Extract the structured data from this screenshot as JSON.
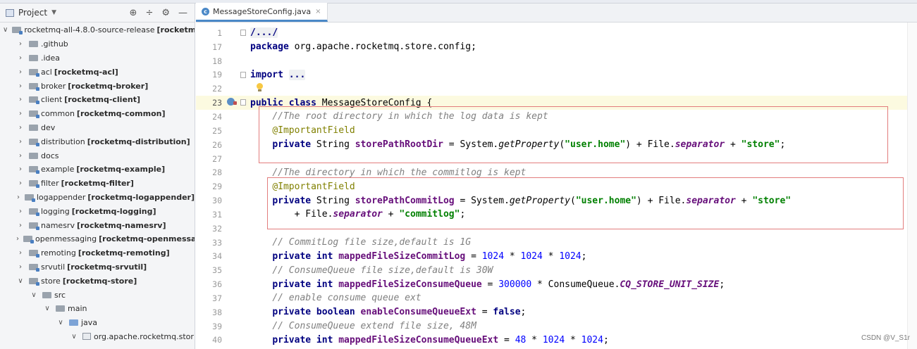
{
  "project_panel": {
    "title": "Project",
    "tree": [
      {
        "indent": 0,
        "arrow": "open",
        "icon": "module",
        "name": "rocketmq-all-4.8.0-source-release",
        "module": "[rocketm"
      },
      {
        "indent": 1,
        "arrow": "closed",
        "icon": "folder",
        "name": ".github",
        "module": ""
      },
      {
        "indent": 1,
        "arrow": "closed",
        "icon": "folder",
        "name": ".idea",
        "module": ""
      },
      {
        "indent": 1,
        "arrow": "closed",
        "icon": "module",
        "name": "acl",
        "module": "[rocketmq-acl]"
      },
      {
        "indent": 1,
        "arrow": "closed",
        "icon": "module",
        "name": "broker",
        "module": "[rocketmq-broker]"
      },
      {
        "indent": 1,
        "arrow": "closed",
        "icon": "module",
        "name": "client",
        "module": "[rocketmq-client]"
      },
      {
        "indent": 1,
        "arrow": "closed",
        "icon": "module",
        "name": "common",
        "module": "[rocketmq-common]"
      },
      {
        "indent": 1,
        "arrow": "closed",
        "icon": "folder",
        "name": "dev",
        "module": ""
      },
      {
        "indent": 1,
        "arrow": "closed",
        "icon": "module",
        "name": "distribution",
        "module": "[rocketmq-distribution]"
      },
      {
        "indent": 1,
        "arrow": "closed",
        "icon": "folder",
        "name": "docs",
        "module": ""
      },
      {
        "indent": 1,
        "arrow": "closed",
        "icon": "module",
        "name": "example",
        "module": "[rocketmq-example]"
      },
      {
        "indent": 1,
        "arrow": "closed",
        "icon": "module",
        "name": "filter",
        "module": "[rocketmq-filter]"
      },
      {
        "indent": 1,
        "arrow": "closed",
        "icon": "module",
        "name": "logappender",
        "module": "[rocketmq-logappender]"
      },
      {
        "indent": 1,
        "arrow": "closed",
        "icon": "module",
        "name": "logging",
        "module": "[rocketmq-logging]"
      },
      {
        "indent": 1,
        "arrow": "closed",
        "icon": "module",
        "name": "namesrv",
        "module": "[rocketmq-namesrv]"
      },
      {
        "indent": 1,
        "arrow": "closed",
        "icon": "module",
        "name": "openmessaging",
        "module": "[rocketmq-openmessa"
      },
      {
        "indent": 1,
        "arrow": "closed",
        "icon": "module",
        "name": "remoting",
        "module": "[rocketmq-remoting]"
      },
      {
        "indent": 1,
        "arrow": "closed",
        "icon": "module",
        "name": "srvutil",
        "module": "[rocketmq-srvutil]"
      },
      {
        "indent": 1,
        "arrow": "open",
        "icon": "module",
        "name": "store",
        "module": "[rocketmq-store]"
      },
      {
        "indent": 2,
        "arrow": "open",
        "icon": "folder",
        "name": "src",
        "module": ""
      },
      {
        "indent": 3,
        "arrow": "open",
        "icon": "folder",
        "name": "main",
        "module": ""
      },
      {
        "indent": 4,
        "arrow": "open",
        "icon": "src",
        "name": "java",
        "module": ""
      },
      {
        "indent": 5,
        "arrow": "open",
        "icon": "package",
        "name": "org.apache.rocketmq.stor",
        "module": ""
      }
    ]
  },
  "editor": {
    "tab_label": "MessageStoreConfig.java",
    "lines": [
      {
        "n": "1",
        "t": [
          [
            "fold",
            "/..."
          ],
          [
            "fold",
            "/"
          ]
        ]
      },
      {
        "n": "17",
        "t": [
          [
            "kw",
            "package"
          ],
          [
            "",
            " org.apache.rocketmq.store.config;"
          ]
        ]
      },
      {
        "n": "18",
        "t": []
      },
      {
        "n": "19",
        "t": [
          [
            "kw",
            "import"
          ],
          [
            "",
            " "
          ],
          [
            "fold",
            "..."
          ]
        ]
      },
      {
        "n": "22",
        "t": []
      },
      {
        "n": "23",
        "t": [
          [
            "kw",
            "public class"
          ],
          [
            "",
            " "
          ],
          [
            "ul",
            "MessageStoreConfig"
          ],
          [
            "",
            " {"
          ]
        ]
      },
      {
        "n": "24",
        "t": [
          [
            "",
            "    "
          ],
          [
            "cm",
            "//The root directory in which the log data is kept"
          ]
        ]
      },
      {
        "n": "25",
        "t": [
          [
            "",
            "    "
          ],
          [
            "an",
            "@ImportantField"
          ]
        ]
      },
      {
        "n": "26",
        "t": [
          [
            "",
            "    "
          ],
          [
            "kw",
            "private"
          ],
          [
            "",
            " String "
          ],
          [
            "fld",
            "storePathRootDir"
          ],
          [
            "",
            " = System."
          ],
          [
            "stat",
            "getProperty"
          ],
          [
            "",
            "("
          ],
          [
            "str",
            "\"user.home\""
          ],
          [
            "",
            ") + File."
          ],
          [
            "sfld",
            "separator"
          ],
          [
            "",
            " + "
          ],
          [
            "str",
            "\"store\""
          ],
          [
            "",
            ";"
          ]
        ]
      },
      {
        "n": "27",
        "t": []
      },
      {
        "n": "28",
        "t": [
          [
            "",
            "    "
          ],
          [
            "cm",
            "//The directory in which the commitlog is kept"
          ]
        ]
      },
      {
        "n": "29",
        "t": [
          [
            "",
            "    "
          ],
          [
            "an",
            "@ImportantField"
          ]
        ]
      },
      {
        "n": "30",
        "t": [
          [
            "",
            "    "
          ],
          [
            "kw",
            "private"
          ],
          [
            "",
            " String "
          ],
          [
            "fld",
            "storePathCommitLog"
          ],
          [
            "",
            " = System."
          ],
          [
            "stat",
            "getProperty"
          ],
          [
            "",
            "("
          ],
          [
            "str",
            "\"user.home\""
          ],
          [
            "",
            ") + File."
          ],
          [
            "sfld",
            "separator"
          ],
          [
            "",
            " + "
          ],
          [
            "str",
            "\"store\""
          ]
        ]
      },
      {
        "n": "31",
        "t": [
          [
            "",
            "        + File."
          ],
          [
            "sfld",
            "separator"
          ],
          [
            "",
            " + "
          ],
          [
            "str",
            "\"commitlog\""
          ],
          [
            "",
            ";"
          ]
        ]
      },
      {
        "n": "32",
        "t": []
      },
      {
        "n": "33",
        "t": [
          [
            "",
            "    "
          ],
          [
            "cm",
            "// CommitLog file size,default is 1G"
          ]
        ]
      },
      {
        "n": "34",
        "t": [
          [
            "",
            "    "
          ],
          [
            "kw",
            "private int"
          ],
          [
            "",
            " "
          ],
          [
            "fld",
            "mappedFileSizeCommitLog"
          ],
          [
            "",
            " = "
          ],
          [
            "num",
            "1024"
          ],
          [
            "",
            " * "
          ],
          [
            "num",
            "1024"
          ],
          [
            "",
            " * "
          ],
          [
            "num",
            "1024"
          ],
          [
            "",
            ";"
          ]
        ]
      },
      {
        "n": "35",
        "t": [
          [
            "",
            "    "
          ],
          [
            "cm",
            "// ConsumeQueue file size,default is 30W"
          ]
        ]
      },
      {
        "n": "36",
        "t": [
          [
            "",
            "    "
          ],
          [
            "kw",
            "private int"
          ],
          [
            "",
            " "
          ],
          [
            "fld",
            "mappedFileSizeConsumeQueue"
          ],
          [
            "",
            " = "
          ],
          [
            "num",
            "300000"
          ],
          [
            "",
            " * ConsumeQueue."
          ],
          [
            "sfld",
            "CQ_STORE_UNIT_SIZE"
          ],
          [
            "",
            ";"
          ]
        ]
      },
      {
        "n": "37",
        "t": [
          [
            "",
            "    "
          ],
          [
            "cm",
            "// enable consume queue ext"
          ]
        ]
      },
      {
        "n": "38",
        "t": [
          [
            "",
            "    "
          ],
          [
            "kw",
            "private boolean"
          ],
          [
            "",
            " "
          ],
          [
            "fld",
            "enableConsumeQueueExt"
          ],
          [
            "",
            " = "
          ],
          [
            "kw",
            "false"
          ],
          [
            "",
            ";"
          ]
        ]
      },
      {
        "n": "39",
        "t": [
          [
            "",
            "    "
          ],
          [
            "cm",
            "// ConsumeQueue extend file size, 48M"
          ]
        ]
      },
      {
        "n": "40",
        "t": [
          [
            "",
            "    "
          ],
          [
            "kw",
            "private int"
          ],
          [
            "",
            " "
          ],
          [
            "fld",
            "mappedFileSizeConsumeQueueExt"
          ],
          [
            "",
            " = "
          ],
          [
            "num",
            "48"
          ],
          [
            "",
            " * "
          ],
          [
            "num",
            "1024"
          ],
          [
            "",
            " * "
          ],
          [
            "num",
            "1024"
          ],
          [
            "",
            ";"
          ]
        ]
      }
    ]
  },
  "watermark": "CSDN @V_S1r",
  "colors": {
    "highlight_box": "#e27d7d",
    "keyword": "#000080",
    "string": "#008000",
    "field": "#660e7a",
    "comment": "#808080",
    "annotation": "#808000",
    "number": "#0000ff"
  }
}
